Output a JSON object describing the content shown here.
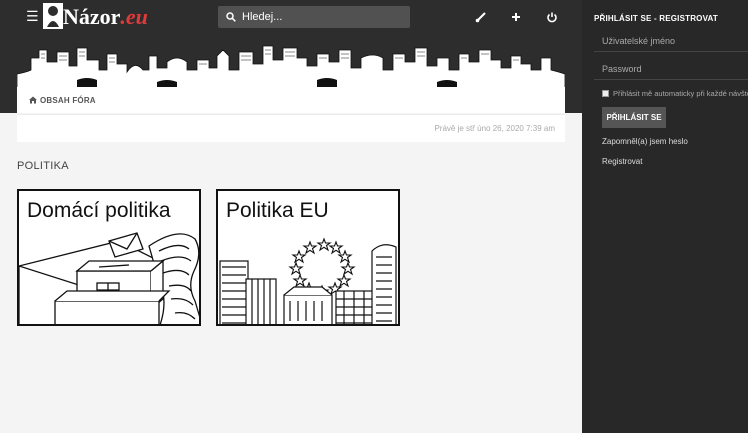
{
  "header": {
    "logo_text": "Názor",
    "logo_suffix": ".eu",
    "search_placeholder": "Hledej..."
  },
  "breadcrumb": {
    "label": "OBSAH FÓRA"
  },
  "date_line": "Právě je stř úno 26, 2020 7:39 am",
  "section": {
    "title": "POLITIKA"
  },
  "forums": [
    {
      "title": "Domácí politika"
    },
    {
      "title": "Politika EU"
    }
  ],
  "sidebar": {
    "title": "PŘIHLÁSIT SE - REGISTROVAT",
    "username_placeholder": "Uživatelské jméno",
    "password_placeholder": "Password",
    "remember_label": "Přihlásit mě automaticky při každé návštěvě",
    "login_button": "PŘIHLÁSIT SE",
    "forgot_link": "Zapomněl(a) jsem heslo",
    "register_link": "Registrovat"
  },
  "colors": {
    "header_bg": "#2d2d2d",
    "sidebar_bg": "#282828",
    "accent_red": "#e03a3a"
  }
}
